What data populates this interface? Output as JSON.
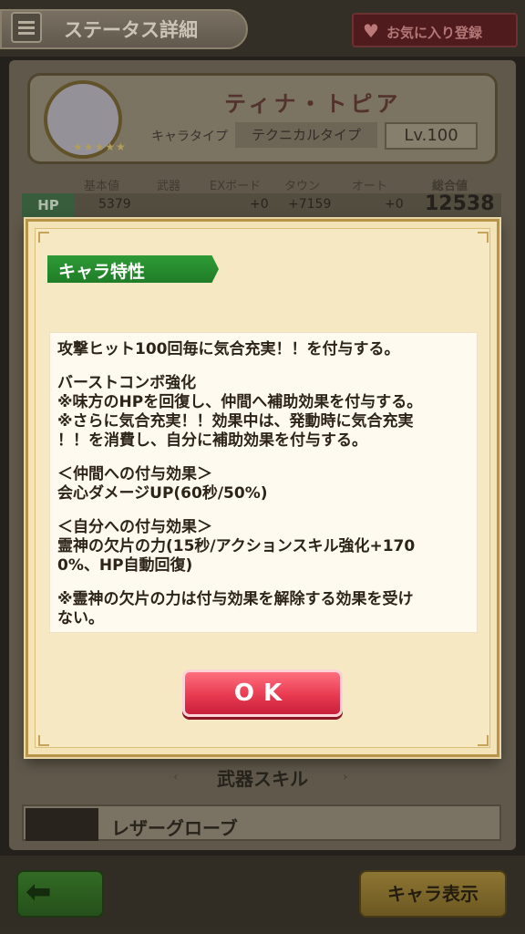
{
  "header": {
    "title": "ステータス詳細",
    "favorite_label": "お気に入り登録"
  },
  "character": {
    "name": "ティナ・トピア",
    "type_label": "キャラタイプ",
    "type_value": "テクニカルタイプ",
    "level": "Lv.100",
    "stars": "★★★★★"
  },
  "stats": {
    "headers": [
      "基本値",
      "武器",
      "EXボード",
      "タウン",
      "オート",
      "総合値"
    ],
    "hp": {
      "label": "HP",
      "base": "5379",
      "exboard": "+0",
      "town": "+7159",
      "auto": "+0",
      "total": "12538"
    }
  },
  "modal": {
    "ribbon_title": "キャラ特性",
    "lines": [
      "攻撃ヒット100回毎に気合充実！！を付与する。",
      "",
      "バーストコンボ強化",
      "※味方のHPを回復し、仲間へ補助効果を付与する。",
      "※さらに気合充実！！効果中は、発動時に気合充実",
      "！！を消費し、自分に補助効果を付与する。",
      "",
      "＜仲間への付与効果＞",
      "会心ダメージUP(60秒/50%)",
      "",
      "＜自分への付与効果＞",
      "霊神の欠片の力(15秒/アクションスキル強化+170",
      "0%、HP自動回復)",
      "",
      "※霊神の欠片の力は付与効果を解除する効果を受け",
      "ない。"
    ],
    "ok_label": "OK"
  },
  "weapon": {
    "section_title": "武器スキル",
    "name": "レザーグローブ"
  },
  "footer": {
    "chara_button": "キャラ表示"
  },
  "icons": {
    "menu": "hamburger-icon",
    "favorite": "heart-icon",
    "back": "back-arrow-icon"
  },
  "colors": {
    "ribbon_green": "#1f7d27",
    "ok_red": "#e83b52",
    "modal_bg": "#f3e3b6"
  }
}
